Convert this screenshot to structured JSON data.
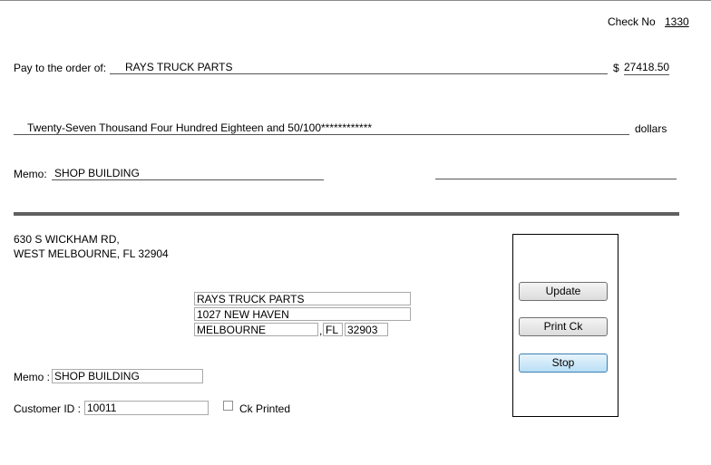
{
  "check": {
    "check_no_label": "Check No",
    "check_no": "1330",
    "pay_label": "Pay to the order of:",
    "payee": "RAYS TRUCK PARTS",
    "dollar_sign": "$",
    "amount": "27418.50",
    "amount_words": "Twenty-Seven Thousand Four Hundred Eighteen and 50/100************",
    "dollars_label": "dollars",
    "memo_label": "Memo:",
    "memo": "SHOP BUILDING"
  },
  "sender": {
    "address1": "630 S WICKHAM RD,",
    "address2": "WEST MELBOURNE, FL 32904"
  },
  "payee_address": {
    "name": "RAYS TRUCK PARTS",
    "street": "1027 NEW HAVEN",
    "city": "MELBOURNE",
    "comma": ",",
    "state": "FL",
    "zip": "32903"
  },
  "form": {
    "memo_label": "Memo :",
    "memo_value": "SHOP BUILDING",
    "customer_id_label": "Customer ID :",
    "customer_id_value": "10011",
    "ck_printed_label": "Ck Printed"
  },
  "buttons": {
    "update": "Update",
    "print": "Print Ck",
    "stop": "Stop"
  }
}
